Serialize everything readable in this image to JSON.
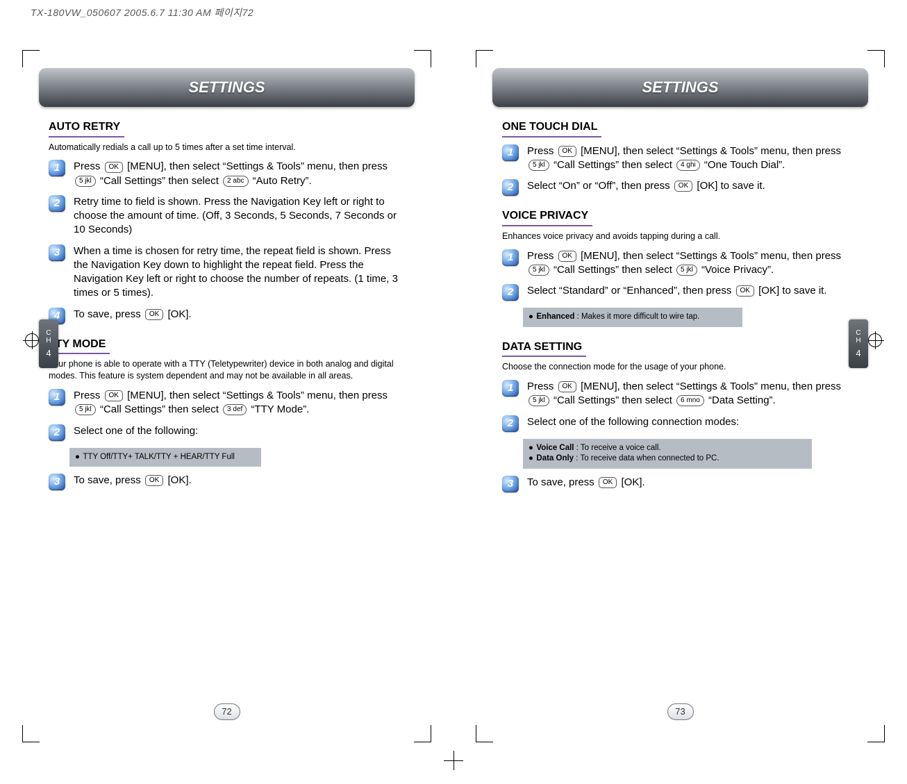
{
  "running_header": "TX-180VW_050607  2005.6.7 11:30 AM  페이지72",
  "banner": {
    "left": "SETTINGS",
    "right": "SETTINGS"
  },
  "sidebar": {
    "label": "C\nH",
    "chapter": "4"
  },
  "page_numbers": {
    "left": "72",
    "right": "73"
  },
  "left": {
    "auto_retry": {
      "title": "AUTO RETRY",
      "intro": "Automatically redials a call up to 5 times after a set time interval.",
      "steps": [
        {
          "n": "1",
          "pre": "Press ",
          "key1": "OK",
          "mid": " [MENU], then select “Settings & Tools” menu, then press ",
          "key2": "5 jkl",
          "mid2": " “Call Settings” then select ",
          "key3": "2 abc",
          "tail": " “Auto Retry”."
        },
        {
          "n": "2",
          "text": "Retry time to field is shown. Press the Navigation Key left or right to choose the amount of time. (Off, 3 Seconds, 5 Seconds, 7 Seconds or 10 Seconds)"
        },
        {
          "n": "3",
          "text": "When a time is chosen for retry time, the repeat field is shown. Press the Navigation Key down to highlight the repeat field. Press the Navigation Key left or right to choose the number of repeats. (1 time, 3 times or 5 times)."
        },
        {
          "n": "4",
          "pre": "To save, press ",
          "key1": "OK",
          "tail": " [OK]."
        }
      ]
    },
    "tty": {
      "title": "TTY MODE",
      "intro": "Your phone is able to operate with a TTY (Teletypewriter) device in both analog and digital modes. This feature is system dependent and may not be available in all areas.",
      "steps": [
        {
          "n": "1",
          "pre": "Press ",
          "key1": "OK",
          "mid": " [MENU], then select “Settings & Tools” menu, then press ",
          "key2": "5 jkl",
          "mid2": " “Call Settings” then select ",
          "key3": "3 def",
          "tail": " “TTY Mode”."
        },
        {
          "n": "2",
          "text": "Select one of the following:"
        },
        {
          "n": "3",
          "pre": "To save, press ",
          "key1": "OK",
          "tail": " [OK]."
        }
      ],
      "info": "TTY Off/TTY+ TALK/TTY + HEAR/TTY Full"
    }
  },
  "right": {
    "one_touch": {
      "title": "ONE TOUCH DIAL",
      "steps": [
        {
          "n": "1",
          "pre": "Press ",
          "key1": "OK",
          "mid": " [MENU], then select “Settings & Tools” menu, then press ",
          "key2": "5 jkl",
          "mid2": " “Call Settings” then select ",
          "key3": "4 ghi",
          "tail": " “One Touch Dial”."
        },
        {
          "n": "2",
          "pre": "Select “On” or “Off”, then press ",
          "key1": "OK",
          "tail": "  [OK] to save it."
        }
      ]
    },
    "voice_privacy": {
      "title": "VOICE PRIVACY",
      "intro": "Enhances voice privacy and avoids tapping during a call.",
      "steps": [
        {
          "n": "1",
          "pre": "Press ",
          "key1": "OK",
          "mid": " [MENU], then select “Settings & Tools” menu, then press ",
          "key2": "5 jkl",
          "mid2": " “Call Settings” then select ",
          "key3": "5 jkl",
          "tail": " “Voice Privacy”."
        },
        {
          "n": "2",
          "pre": "Select “Standard” or “Enhanced”, then press ",
          "key1": "OK",
          "tail": "  [OK] to save it."
        }
      ],
      "info_label": "Enhanced",
      "info_text": " : Makes it more difficult to wire tap."
    },
    "data_setting": {
      "title": "DATA SETTING",
      "intro": "Choose the connection mode for the usage of your phone.",
      "steps": [
        {
          "n": "1",
          "pre": "Press ",
          "key1": "OK",
          "mid": " [MENU], then select “Settings & Tools” menu, then press ",
          "key2": "5 jkl",
          "mid2": " “Call Settings” then select ",
          "key3": "6 mno",
          "tail": " “Data Setting”."
        },
        {
          "n": "2",
          "text": "Select one of the following connection modes:"
        },
        {
          "n": "3",
          "pre": "To save, press ",
          "key1": "OK",
          "tail": " [OK]."
        }
      ],
      "info": [
        {
          "label": "Voice Call",
          "text": " : To receive a voice call."
        },
        {
          "label": "Data Only",
          "text": " : To receive data when connected to PC."
        }
      ]
    }
  }
}
